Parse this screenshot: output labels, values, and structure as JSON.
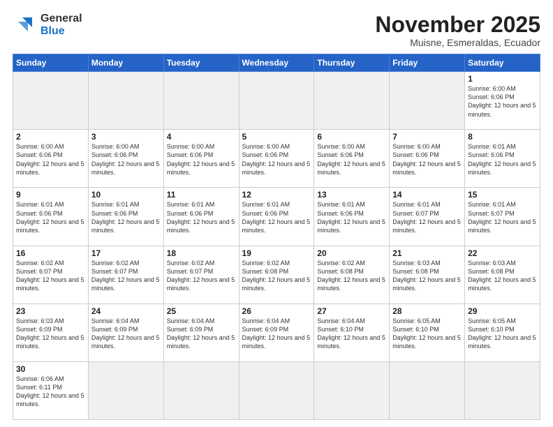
{
  "logo": {
    "line1": "General",
    "line2": "Blue"
  },
  "title": "November 2025",
  "subtitle": "Muisne, Esmeraldas, Ecuador",
  "weekdays": [
    "Sunday",
    "Monday",
    "Tuesday",
    "Wednesday",
    "Thursday",
    "Friday",
    "Saturday"
  ],
  "weeks": [
    [
      {
        "day": "",
        "info": "",
        "empty": true
      },
      {
        "day": "",
        "info": "",
        "empty": true
      },
      {
        "day": "",
        "info": "",
        "empty": true
      },
      {
        "day": "",
        "info": "",
        "empty": true
      },
      {
        "day": "",
        "info": "",
        "empty": true
      },
      {
        "day": "",
        "info": "",
        "empty": true
      },
      {
        "day": "1",
        "info": "Sunrise: 6:00 AM\nSunset: 6:06 PM\nDaylight: 12 hours and 5 minutes."
      }
    ],
    [
      {
        "day": "2",
        "info": "Sunrise: 6:00 AM\nSunset: 6:06 PM\nDaylight: 12 hours and 5 minutes."
      },
      {
        "day": "3",
        "info": "Sunrise: 6:00 AM\nSunset: 6:06 PM\nDaylight: 12 hours and 5 minutes."
      },
      {
        "day": "4",
        "info": "Sunrise: 6:00 AM\nSunset: 6:06 PM\nDaylight: 12 hours and 5 minutes."
      },
      {
        "day": "5",
        "info": "Sunrise: 6:00 AM\nSunset: 6:06 PM\nDaylight: 12 hours and 5 minutes."
      },
      {
        "day": "6",
        "info": "Sunrise: 6:00 AM\nSunset: 6:06 PM\nDaylight: 12 hours and 5 minutes."
      },
      {
        "day": "7",
        "info": "Sunrise: 6:00 AM\nSunset: 6:06 PM\nDaylight: 12 hours and 5 minutes."
      },
      {
        "day": "8",
        "info": "Sunrise: 6:01 AM\nSunset: 6:06 PM\nDaylight: 12 hours and 5 minutes."
      }
    ],
    [
      {
        "day": "9",
        "info": "Sunrise: 6:01 AM\nSunset: 6:06 PM\nDaylight: 12 hours and 5 minutes."
      },
      {
        "day": "10",
        "info": "Sunrise: 6:01 AM\nSunset: 6:06 PM\nDaylight: 12 hours and 5 minutes."
      },
      {
        "day": "11",
        "info": "Sunrise: 6:01 AM\nSunset: 6:06 PM\nDaylight: 12 hours and 5 minutes."
      },
      {
        "day": "12",
        "info": "Sunrise: 6:01 AM\nSunset: 6:06 PM\nDaylight: 12 hours and 5 minutes."
      },
      {
        "day": "13",
        "info": "Sunrise: 6:01 AM\nSunset: 6:06 PM\nDaylight: 12 hours and 5 minutes."
      },
      {
        "day": "14",
        "info": "Sunrise: 6:01 AM\nSunset: 6:07 PM\nDaylight: 12 hours and 5 minutes."
      },
      {
        "day": "15",
        "info": "Sunrise: 6:01 AM\nSunset: 6:07 PM\nDaylight: 12 hours and 5 minutes."
      }
    ],
    [
      {
        "day": "16",
        "info": "Sunrise: 6:02 AM\nSunset: 6:07 PM\nDaylight: 12 hours and 5 minutes."
      },
      {
        "day": "17",
        "info": "Sunrise: 6:02 AM\nSunset: 6:07 PM\nDaylight: 12 hours and 5 minutes."
      },
      {
        "day": "18",
        "info": "Sunrise: 6:02 AM\nSunset: 6:07 PM\nDaylight: 12 hours and 5 minutes."
      },
      {
        "day": "19",
        "info": "Sunrise: 6:02 AM\nSunset: 6:08 PM\nDaylight: 12 hours and 5 minutes."
      },
      {
        "day": "20",
        "info": "Sunrise: 6:02 AM\nSunset: 6:08 PM\nDaylight: 12 hours and 5 minutes."
      },
      {
        "day": "21",
        "info": "Sunrise: 6:03 AM\nSunset: 6:08 PM\nDaylight: 12 hours and 5 minutes."
      },
      {
        "day": "22",
        "info": "Sunrise: 6:03 AM\nSunset: 6:08 PM\nDaylight: 12 hours and 5 minutes."
      }
    ],
    [
      {
        "day": "23",
        "info": "Sunrise: 6:03 AM\nSunset: 6:09 PM\nDaylight: 12 hours and 5 minutes."
      },
      {
        "day": "24",
        "info": "Sunrise: 6:04 AM\nSunset: 6:09 PM\nDaylight: 12 hours and 5 minutes."
      },
      {
        "day": "25",
        "info": "Sunrise: 6:04 AM\nSunset: 6:09 PM\nDaylight: 12 hours and 5 minutes."
      },
      {
        "day": "26",
        "info": "Sunrise: 6:04 AM\nSunset: 6:09 PM\nDaylight: 12 hours and 5 minutes."
      },
      {
        "day": "27",
        "info": "Sunrise: 6:04 AM\nSunset: 6:10 PM\nDaylight: 12 hours and 5 minutes."
      },
      {
        "day": "28",
        "info": "Sunrise: 6:05 AM\nSunset: 6:10 PM\nDaylight: 12 hours and 5 minutes."
      },
      {
        "day": "29",
        "info": "Sunrise: 6:05 AM\nSunset: 6:10 PM\nDaylight: 12 hours and 5 minutes."
      }
    ],
    [
      {
        "day": "30",
        "info": "Sunrise: 6:06 AM\nSunset: 6:11 PM\nDaylight: 12 hours and 5 minutes."
      },
      {
        "day": "",
        "info": "",
        "empty": true
      },
      {
        "day": "",
        "info": "",
        "empty": true
      },
      {
        "day": "",
        "info": "",
        "empty": true
      },
      {
        "day": "",
        "info": "",
        "empty": true
      },
      {
        "day": "",
        "info": "",
        "empty": true
      },
      {
        "day": "",
        "info": "",
        "empty": true
      }
    ]
  ]
}
